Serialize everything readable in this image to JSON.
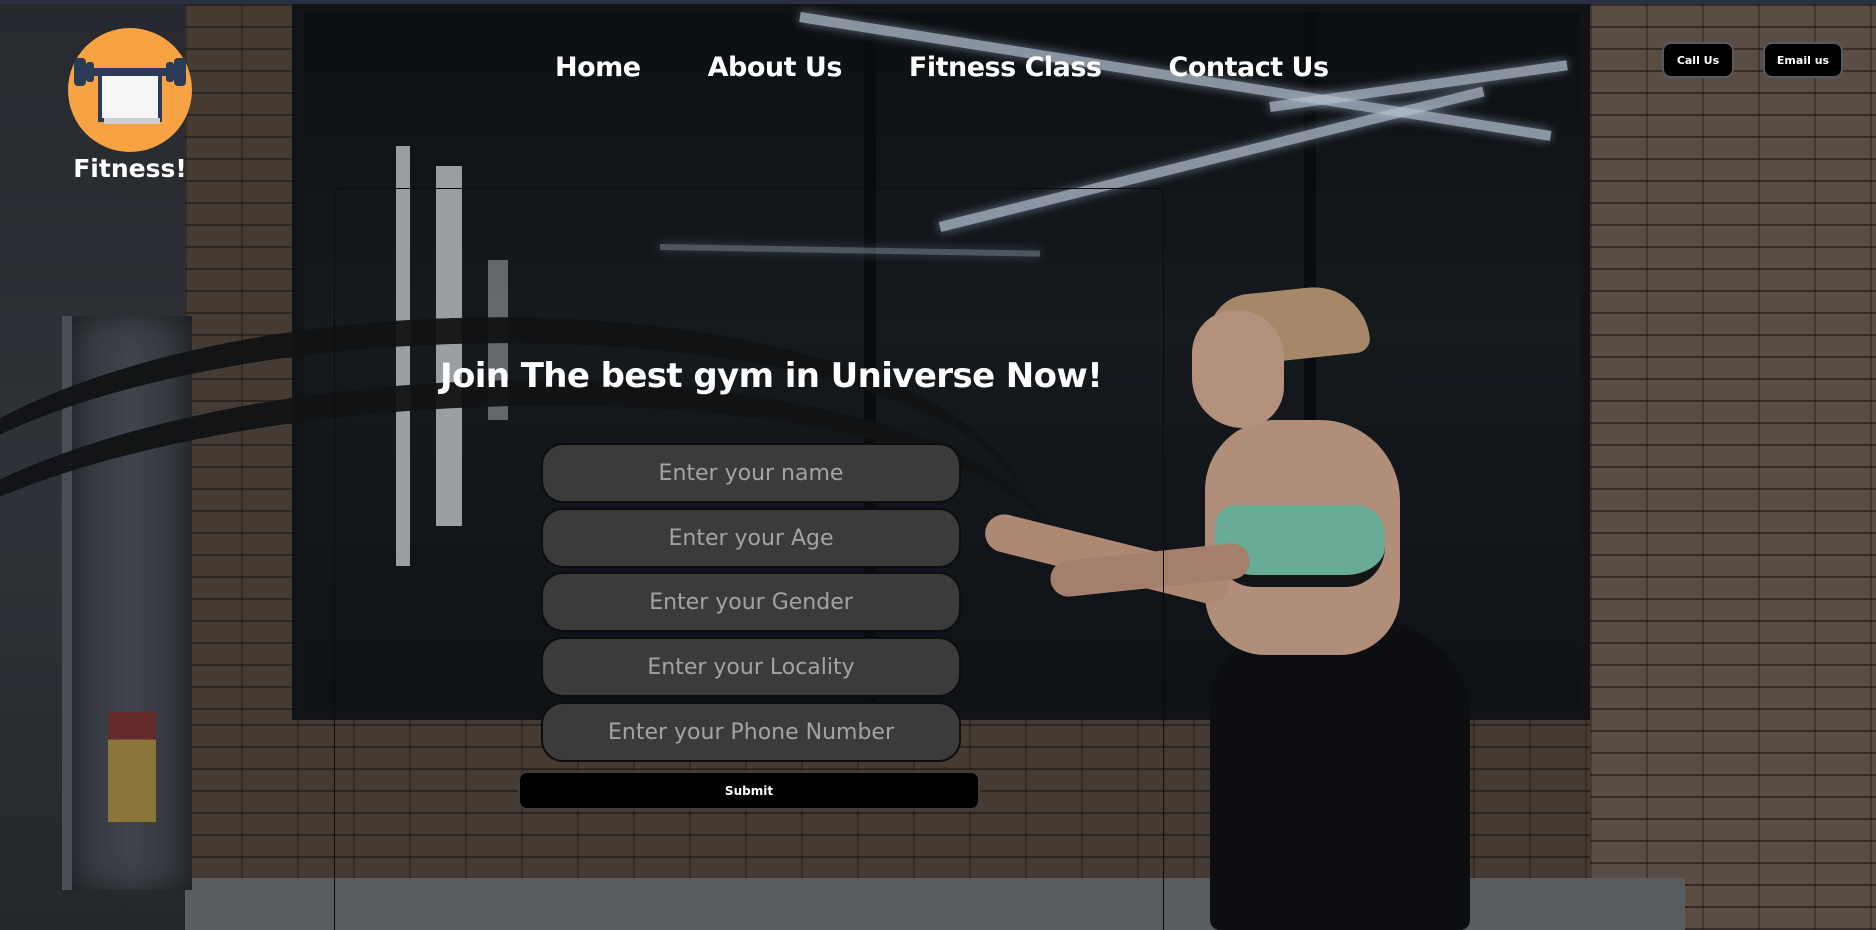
{
  "brand": {
    "name": "Fitness!",
    "logo_icon": "barbell-bench-icon",
    "logo_color": "#f7a243"
  },
  "nav": {
    "items": [
      {
        "label": "Home"
      },
      {
        "label": "About Us"
      },
      {
        "label": "Fitness Class"
      },
      {
        "label": "Contact Us"
      }
    ]
  },
  "header_buttons": {
    "call": "Call Us",
    "email": "Email us"
  },
  "form": {
    "headline": "Join The best gym in Universe Now!",
    "fields": [
      {
        "placeholder": "Enter your name"
      },
      {
        "placeholder": "Enter your Age"
      },
      {
        "placeholder": "Enter your Gender"
      },
      {
        "placeholder": "Enter your Locality"
      },
      {
        "placeholder": "Enter your Phone Number"
      }
    ],
    "submit_label": "Submit"
  },
  "background": {
    "description_icon": "gym-hero-background"
  },
  "colors": {
    "field_bg": "#3b3b3b",
    "field_text": "#a3a3a3",
    "button_bg": "#000000",
    "text": "#ffffff"
  }
}
